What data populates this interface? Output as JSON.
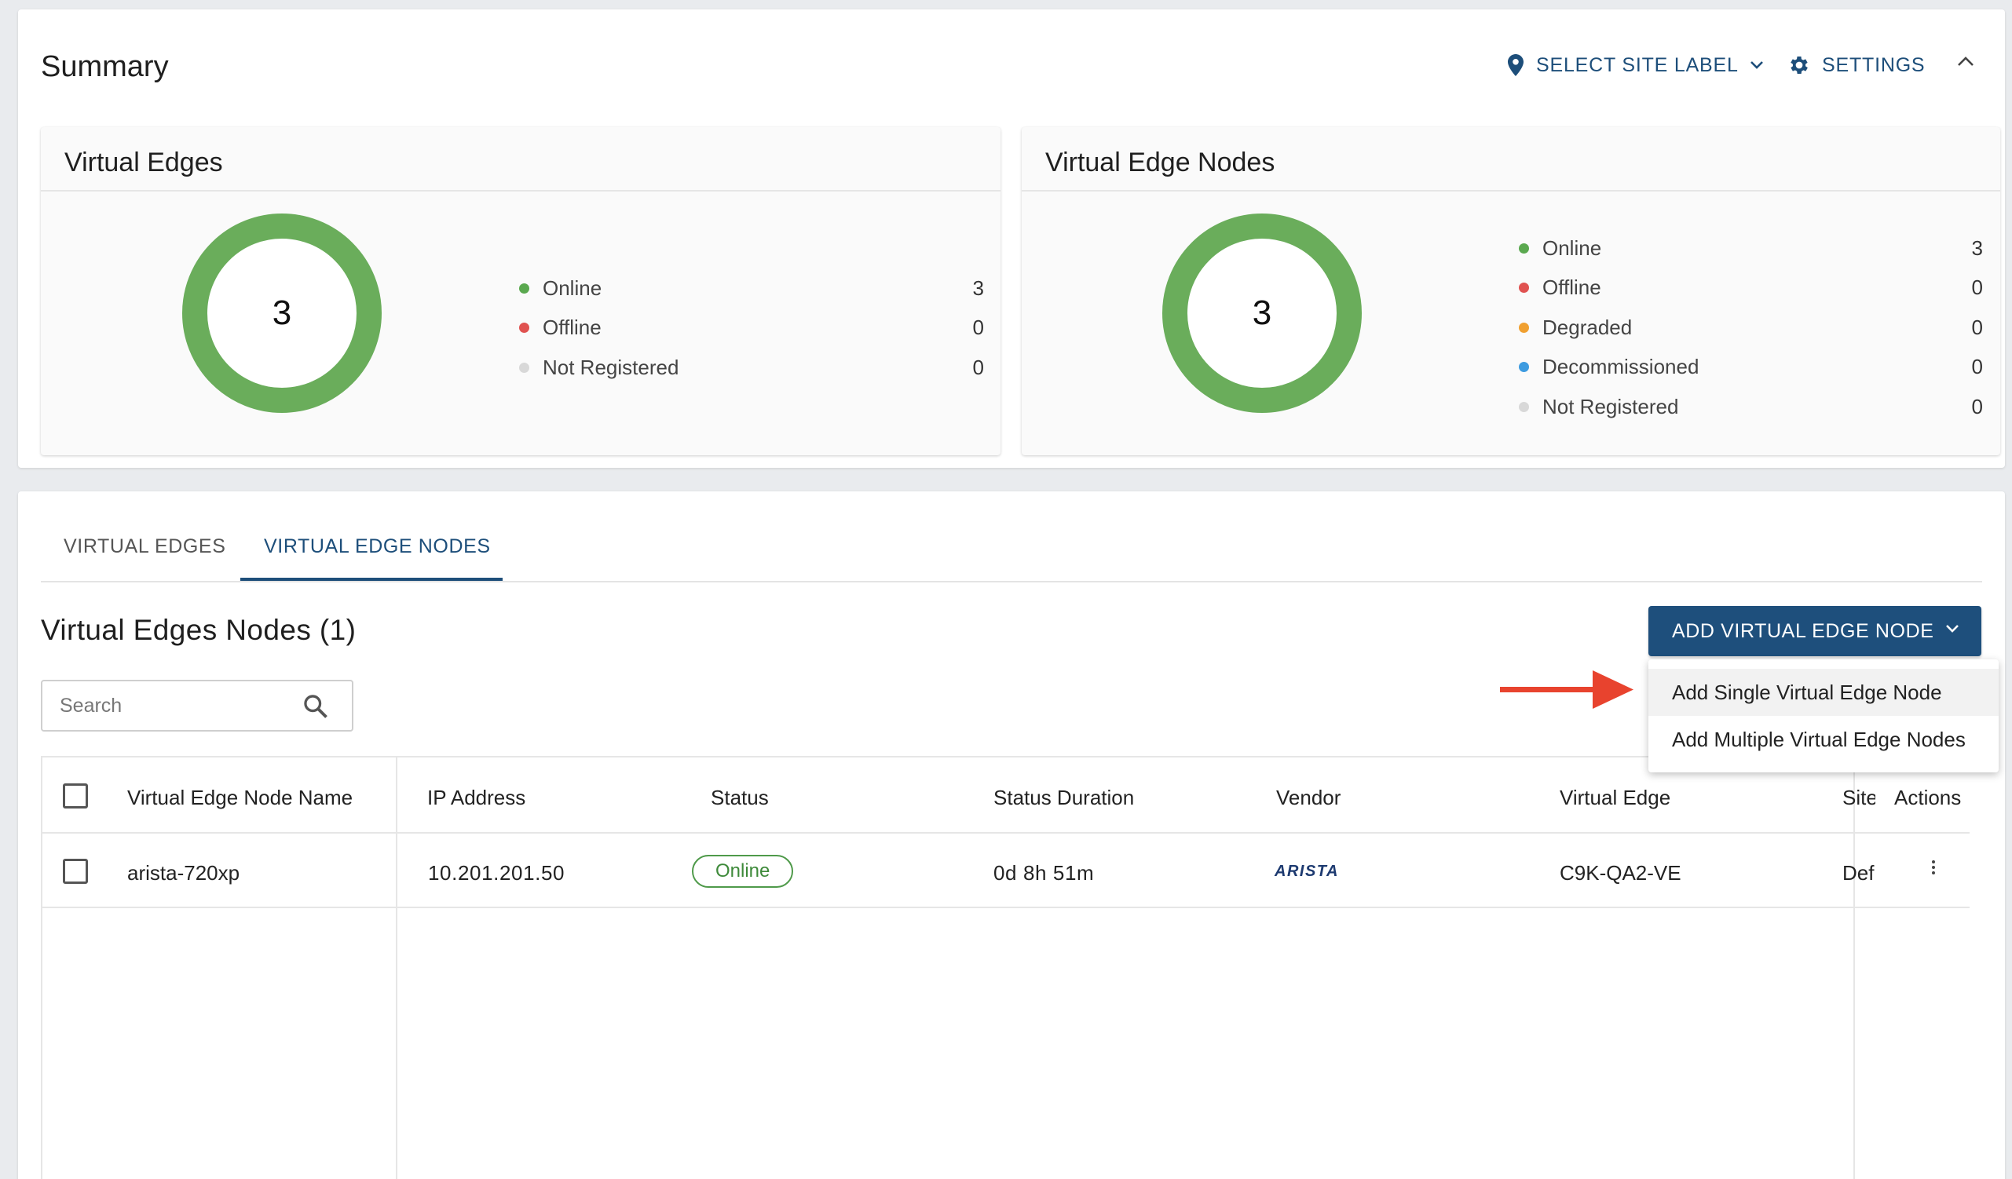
{
  "summary": {
    "title": "Summary",
    "site_label": "SELECT SITE LABEL",
    "settings": "SETTINGS"
  },
  "virtual_edges_card": {
    "title": "Virtual Edges",
    "total": "3",
    "legend": [
      {
        "label": "Online",
        "value": "3",
        "color": "#5aa84f"
      },
      {
        "label": "Offline",
        "value": "0",
        "color": "#e05250"
      },
      {
        "label": "Not Registered",
        "value": "0",
        "color": "#d8d8d8"
      }
    ]
  },
  "virtual_edge_nodes_card": {
    "title": "Virtual Edge Nodes",
    "total": "3",
    "legend": [
      {
        "label": "Online",
        "value": "3",
        "color": "#5aa84f"
      },
      {
        "label": "Offline",
        "value": "0",
        "color": "#e05250"
      },
      {
        "label": "Degraded",
        "value": "0",
        "color": "#f0a030"
      },
      {
        "label": "Decommissioned",
        "value": "0",
        "color": "#3d9be0"
      },
      {
        "label": "Not Registered",
        "value": "0",
        "color": "#d8d8d8"
      }
    ]
  },
  "tabs": [
    {
      "label": "VIRTUAL EDGES",
      "active": false
    },
    {
      "label": "VIRTUAL EDGE NODES",
      "active": true
    }
  ],
  "list": {
    "title": "Virtual Edges Nodes (1)",
    "add_button": "ADD VIRTUAL EDGE NODE",
    "search_placeholder": "Search"
  },
  "menu": {
    "items": [
      "Add Single Virtual Edge Node",
      "Add Multiple Virtual Edge Nodes"
    ]
  },
  "table": {
    "columns": [
      "Virtual Edge Node Name",
      "IP Address",
      "Status",
      "Status Duration",
      "Vendor",
      "Virtual Edge",
      "Site",
      "Actions"
    ],
    "rows": [
      {
        "name": "arista-720xp",
        "ip": "10.201.201.50",
        "status": "Online",
        "duration": "0d 8h 51m",
        "vendor": "ARISTA",
        "virtual_edge": "C9K-QA2-VE",
        "site": "Def"
      }
    ]
  },
  "colors": {
    "accent": "#1e4f7c",
    "online": "#6aad5b",
    "arrow": "#e8432e"
  }
}
